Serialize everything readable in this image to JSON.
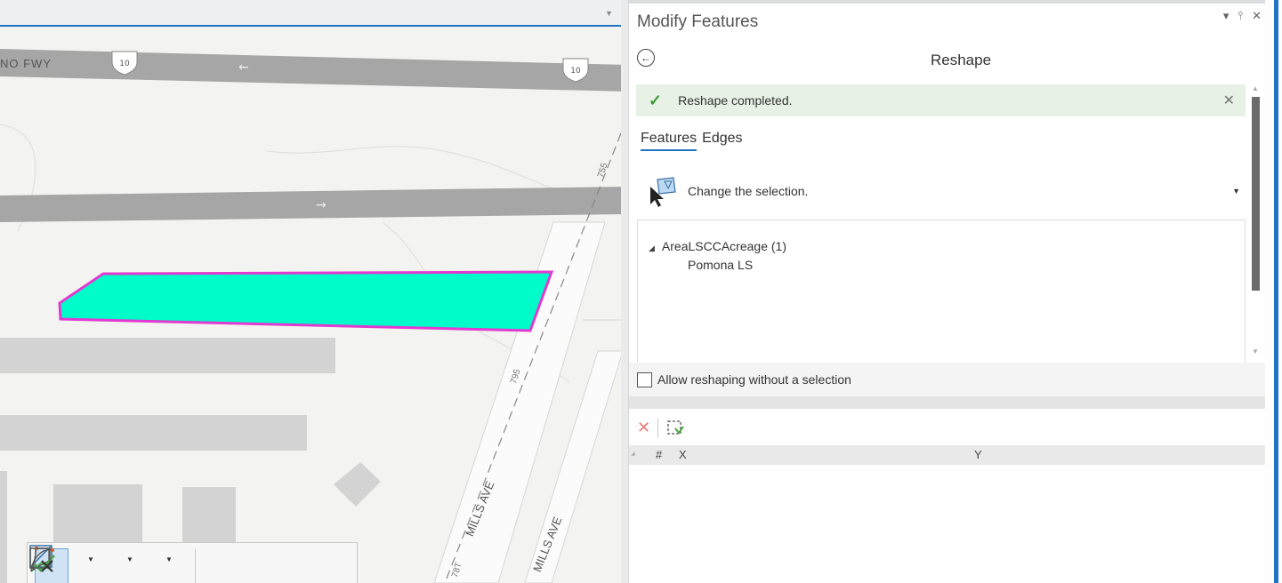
{
  "map": {
    "road_label_freeway": "NO FWY",
    "shield_number": "10",
    "shield_number_2": "10",
    "road_label_mills_1": "MILLS AVE",
    "road_label_mills_2": "MILLS AVE",
    "contour_label_1": "755",
    "contour_label_2": "795",
    "contour_label_3": "78T",
    "selected_feature_fill": "#00fdc9",
    "selected_feature_outline": "#e23ad0"
  },
  "pane": {
    "title": "Modify Features",
    "controls": {
      "menu": "▾",
      "pin": "⫯",
      "close": "✕"
    },
    "tool_name": "Reshape",
    "message": {
      "icon": "check-icon",
      "text": "Reshape completed."
    },
    "tabs": [
      {
        "label": "Features"
      },
      {
        "label": "Edges"
      }
    ],
    "selection": {
      "text": "Change the selection."
    },
    "tree": {
      "layer": "AreaLSCCAcreage (1)",
      "feature": "Pomona LS"
    },
    "allow_label": "Allow reshaping without a selection",
    "vertex_table": {
      "columns": [
        "#",
        "X",
        "Y"
      ]
    }
  },
  "colors": {
    "accent": "#1f74c4",
    "success_bg": "#e7f1e5",
    "success_icon": "#3e9a3a"
  }
}
